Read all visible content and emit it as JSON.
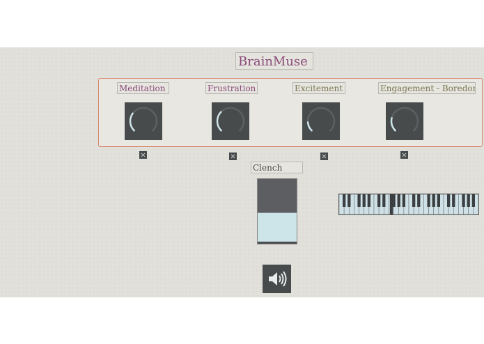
{
  "app": {
    "title": "BrainMuse"
  },
  "colors": {
    "title_text": "#8a4a78",
    "panel_border": "#d8876b",
    "knob_body": "#474b4c",
    "knob_arc": "#cde4e8",
    "slider_fill": "#cde4e8"
  },
  "knobs": [
    {
      "label": "Meditation",
      "value": 0.3
    },
    {
      "label": "Frustration",
      "value": 0.33
    },
    {
      "label": "Excitement",
      "value": 0.15
    },
    {
      "label": "Engagement - Boredom",
      "value": 0.22
    }
  ],
  "toggles": [
    {
      "icon": "x-icon"
    },
    {
      "icon": "x-icon"
    },
    {
      "icon": "x-icon"
    },
    {
      "icon": "x-icon"
    }
  ],
  "clench": {
    "label": "Clench",
    "value": 0.47
  },
  "keyboard": {
    "icon": "piano-keyboard-icon",
    "pressed_key": "F4"
  },
  "speaker": {
    "icon": "speaker-volume-icon"
  }
}
